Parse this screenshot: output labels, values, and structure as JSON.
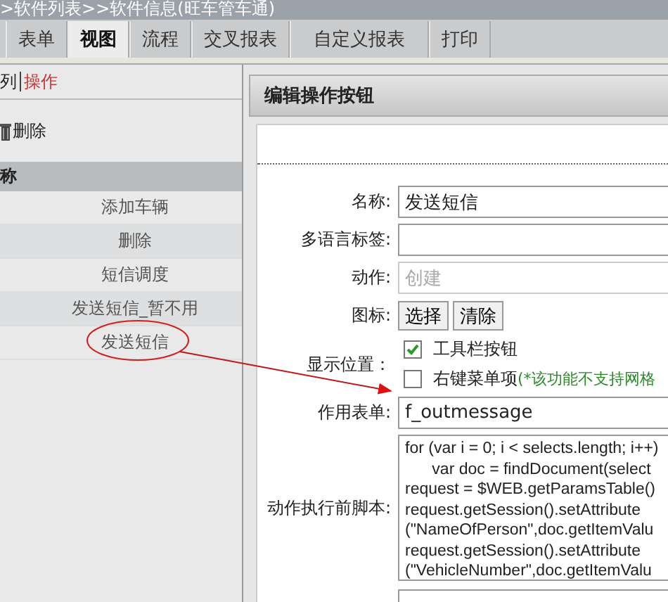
{
  "window": {
    "title": ">软件列表>>软件信息(旺车管车通)"
  },
  "tabs": [
    {
      "label": "表单",
      "selected": false
    },
    {
      "label": "视图",
      "selected": true
    },
    {
      "label": "流程",
      "selected": false
    },
    {
      "label": "交叉报表",
      "selected": false
    },
    {
      "label": "自定义报表",
      "selected": false
    },
    {
      "label": "打印",
      "selected": false
    }
  ],
  "sidebar": {
    "subtabs": [
      {
        "label": "列",
        "selected": false
      },
      {
        "label": "操作",
        "selected": true
      }
    ],
    "delete_button": "删除",
    "table_header": "称",
    "rows": [
      {
        "label": "添加车辆",
        "circled": false
      },
      {
        "label": "删除",
        "circled": false
      },
      {
        "label": "短信调度",
        "circled": false
      },
      {
        "label": "发送短信_暂不用",
        "circled": false
      },
      {
        "label": "发送短信",
        "circled": true
      }
    ]
  },
  "panel": {
    "title": "编辑操作按钮",
    "fields": [
      {
        "kind": "input",
        "label": "名称:",
        "value": "发送短信"
      },
      {
        "kind": "input",
        "label": "多语言标签:"
      },
      {
        "kind": "disabled",
        "label": "动作:",
        "value": "创建"
      },
      {
        "kind": "buttons",
        "label": "图标:",
        "buttons": [
          "选择",
          "清除"
        ]
      },
      {
        "kind": "checks",
        "label": "显示位置：",
        "checks": [
          {
            "label": "工具栏按钮",
            "checked": true
          },
          {
            "label": "右键菜单项",
            "checked": false,
            "note": "(*该功能不支持网格"
          }
        ]
      },
      {
        "kind": "input",
        "label": "作用表单:",
        "value": "f_outmessage"
      },
      {
        "kind": "script",
        "label": "动作执行前脚本:",
        "lines": [
          "for (var i = 0; i < selects.length; i++)",
          "      var doc = findDocument(select",
          "request = $WEB.getParamsTable()",
          "request.getSession().setAttribute",
          "(\"NameOfPerson\",doc.getItemValu",
          "request.getSession().setAttribute",
          "(\"VehicleNumber\",doc.getItemValu"
        ]
      }
    ]
  }
}
